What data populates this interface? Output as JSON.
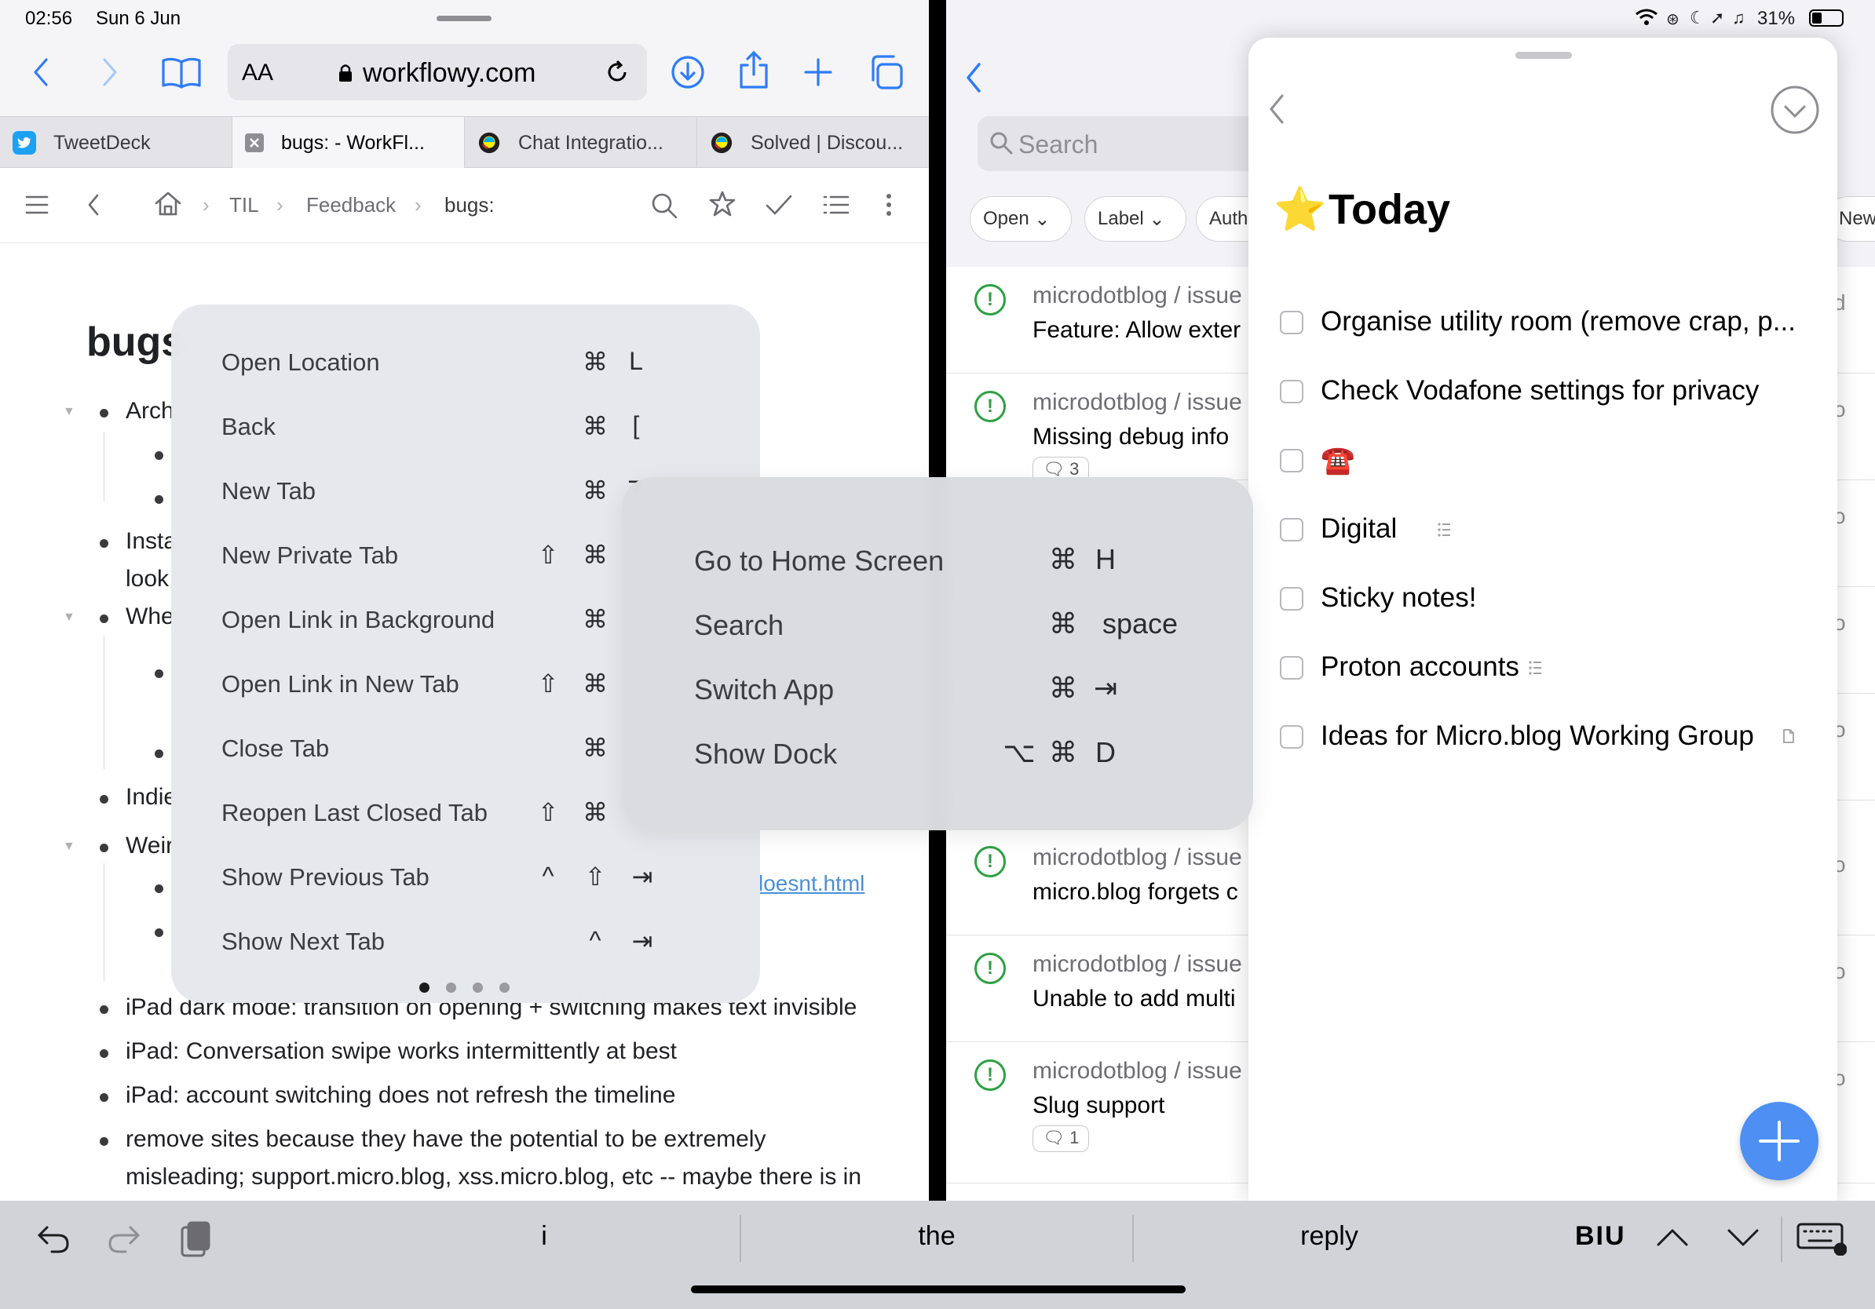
{
  "status": {
    "time": "02:56",
    "date": "Sun 6 Jun",
    "battery": "31%"
  },
  "safari": {
    "address": {
      "aa_label": "AA",
      "url": "workflowy.com"
    },
    "tabs": [
      {
        "title": "TweetDeck",
        "icon": "twitter-icon"
      },
      {
        "title": "bugs: - WorkFl...",
        "icon": "close-icon"
      },
      {
        "title": "Chat Integratio...",
        "icon": "discourse-icon"
      },
      {
        "title": "Solved | Discou...",
        "icon": "discourse-icon"
      }
    ]
  },
  "workflowy": {
    "breadcrumb": [
      "TIL",
      "Feedback",
      "bugs:"
    ],
    "title": "bugs",
    "items": [
      {
        "text": "Arch"
      },
      {
        "text": "Insta"
      },
      {
        "text": "look"
      },
      {
        "text": "Whe"
      },
      {
        "text": "Indie"
      },
      {
        "text": "Weir"
      },
      {
        "text": "iPad dark mode: transition on opening + switching makes text invisible"
      },
      {
        "text": "iPad: Conversation swipe works intermittently at best"
      },
      {
        "text": "iPad: account switching does not refresh the timeline"
      },
      {
        "text": "remove sites because they have the potential to be extremely"
      },
      {
        "text": "misleading; support.micro.blog, xss.micro.blog, etc -- maybe there is in"
      }
    ],
    "link_fragment": "loesnt.html"
  },
  "shortcuts_safari": {
    "rows": [
      {
        "label": "Open Location",
        "keys": [
          "⌘",
          "L"
        ]
      },
      {
        "label": "Back",
        "keys": [
          "⌘",
          "["
        ]
      },
      {
        "label": "New Tab",
        "keys": [
          "⌘",
          "T"
        ]
      },
      {
        "label": "New Private Tab",
        "keys": [
          "⇧",
          "⌘"
        ]
      },
      {
        "label": "Open Link in Background",
        "keys": [
          "⌘"
        ]
      },
      {
        "label": "Open Link in New Tab",
        "keys": [
          "⇧",
          "⌘"
        ]
      },
      {
        "label": "Close Tab",
        "keys": [
          "⌘"
        ]
      },
      {
        "label": "Reopen Last Closed Tab",
        "keys": [
          "⇧",
          "⌘"
        ]
      },
      {
        "label": "Show Previous Tab",
        "keys": [
          "^",
          "⇧",
          "⇥"
        ]
      },
      {
        "label": "Show Next Tab",
        "keys": [
          "^",
          "⇥"
        ]
      }
    ],
    "pages": 4,
    "current_page": 1
  },
  "shortcuts_system": {
    "rows": [
      {
        "label": "Go to Home Screen",
        "keys": [
          "⌘",
          "H"
        ]
      },
      {
        "label": "Search",
        "keys": [
          "⌘",
          "space"
        ]
      },
      {
        "label": "Switch App",
        "keys": [
          "⌘",
          "⇥"
        ]
      },
      {
        "label": "Show Dock",
        "keys": [
          "⌥",
          "⌘",
          "D"
        ]
      }
    ]
  },
  "github": {
    "search_placeholder": "Search",
    "filters": [
      "Open",
      "Label",
      "Auth"
    ],
    "filter_right": "Newe",
    "issues": [
      {
        "repo": "microdotblog / issue",
        "title": "Feature: Allow exter",
        "side": "d"
      },
      {
        "repo": "microdotblog / issue",
        "title": "Missing debug info",
        "badge": "3",
        "side": "o"
      },
      {
        "repo": "microdotblog / issue",
        "title": "micro.blog forgets c",
        "side": "o"
      },
      {
        "repo": "microdotblog / issue",
        "title": "Unable to add multi",
        "side": "o"
      },
      {
        "repo": "microdotblog / issue",
        "title": "Slug support",
        "badge": "1",
        "side": "o"
      }
    ],
    "hidden_row_sides": [
      "o",
      "o",
      "o"
    ]
  },
  "things": {
    "title": "Today",
    "star": "⭐",
    "todos": [
      {
        "label": "Organise utility room (remove crap, p...",
        "note": ""
      },
      {
        "label": "Check Vodafone settings for privacy",
        "note": ""
      },
      {
        "label": "☎️",
        "note": ""
      },
      {
        "label": "Digital",
        "note": "checklist-icon"
      },
      {
        "label": "Sticky notes!",
        "note": ""
      },
      {
        "label": "Proton accounts",
        "note": "checklist-icon"
      },
      {
        "label": "Ideas for Micro.blog Working Group",
        "note": "note-icon"
      }
    ]
  },
  "quicktype": {
    "suggestions": [
      "i",
      "the",
      "reply"
    ],
    "format": "BIU"
  },
  "colors": {
    "accent": "#2f7cf6",
    "issue_open": "#2ea043",
    "fab": "#4d8ff3"
  }
}
